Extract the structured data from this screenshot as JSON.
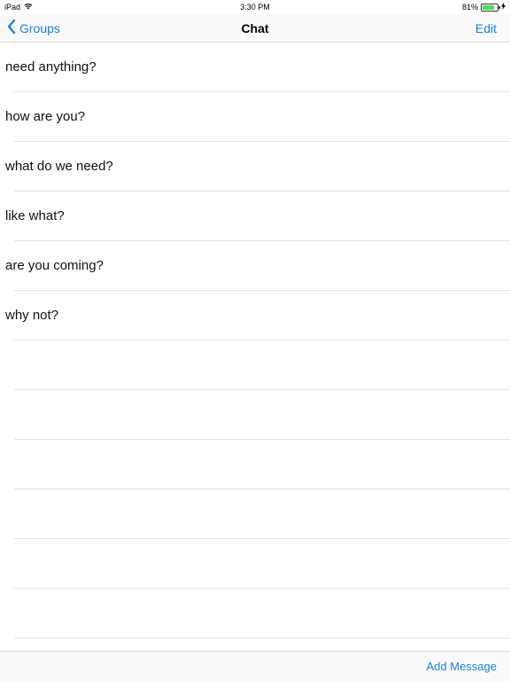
{
  "status": {
    "device": "iPad",
    "wifi_icon": "wifi-icon",
    "time": "3:30 PM",
    "battery_text": "81%",
    "battery_level": 0.81,
    "battery_color": "#4cd964",
    "charging_icon": "bolt-icon"
  },
  "nav": {
    "back_label": "Groups",
    "back_icon": "chevron-left-icon",
    "title": "Chat",
    "edit_label": "Edit",
    "accent": "#1f7fe3"
  },
  "messages": [
    "need anything?",
    "how are you?",
    "what do we need?",
    "like what?",
    "are you coming?",
    "why not?",
    "",
    "",
    "",
    "",
    "",
    "",
    ""
  ],
  "toolbar": {
    "add_message_label": "Add Message"
  }
}
